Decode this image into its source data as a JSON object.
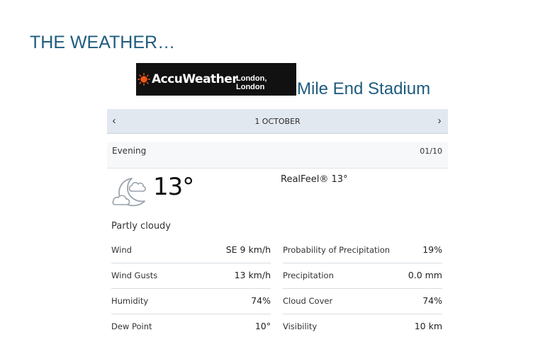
{
  "slide": {
    "title": "THE WEATHER…",
    "venue": "Mile End Stadium"
  },
  "logo": {
    "brand": "AccuWeather",
    "location": "London, London",
    "icon": "sun-icon",
    "brand_color": "#f05514"
  },
  "forecast": {
    "date_label": "1 OCTOBER",
    "prev_icon": "chevron-left-icon",
    "next_icon": "chevron-right-icon",
    "period": "Evening",
    "period_date": "01/10",
    "weather_icon": "partly-cloudy-night-icon",
    "temperature": "13°",
    "realfeel": "RealFeel® 13°",
    "condition": "Partly cloudy",
    "details_left": [
      {
        "label": "Wind",
        "value": "SE 9 km/h"
      },
      {
        "label": "Wind Gusts",
        "value": "13 km/h"
      },
      {
        "label": "Humidity",
        "value": "74%"
      },
      {
        "label": "Dew Point",
        "value": "10°"
      }
    ],
    "details_right": [
      {
        "label": "Probability of Precipitation",
        "value": "19%"
      },
      {
        "label": "Precipitation",
        "value": "0.0 mm"
      },
      {
        "label": "Cloud Cover",
        "value": "74%"
      },
      {
        "label": "Visibility",
        "value": "10 km"
      }
    ]
  },
  "colors": {
    "title": "#1f5c7f",
    "date_bar": "#e2e8ef",
    "logo_bg": "#111111"
  }
}
